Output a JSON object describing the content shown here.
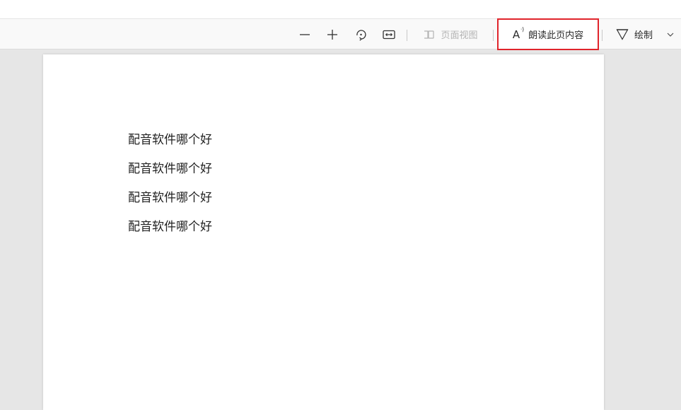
{
  "toolbar": {
    "zoom_out_icon": "minus-icon",
    "zoom_in_icon": "plus-icon",
    "rotate_icon": "rotate-icon",
    "fit_icon": "fit-width-icon",
    "page_view_label": "页面视图",
    "read_aloud_glyph": "A",
    "read_aloud_sup": "ᐧ)",
    "read_aloud_label": "朗读此页内容",
    "draw_label": "绘制",
    "highlight_color": "#e0242b"
  },
  "document": {
    "lines": [
      "配音软件哪个好",
      "配音软件哪个好",
      "配音软件哪个好",
      "配音软件哪个好"
    ]
  }
}
